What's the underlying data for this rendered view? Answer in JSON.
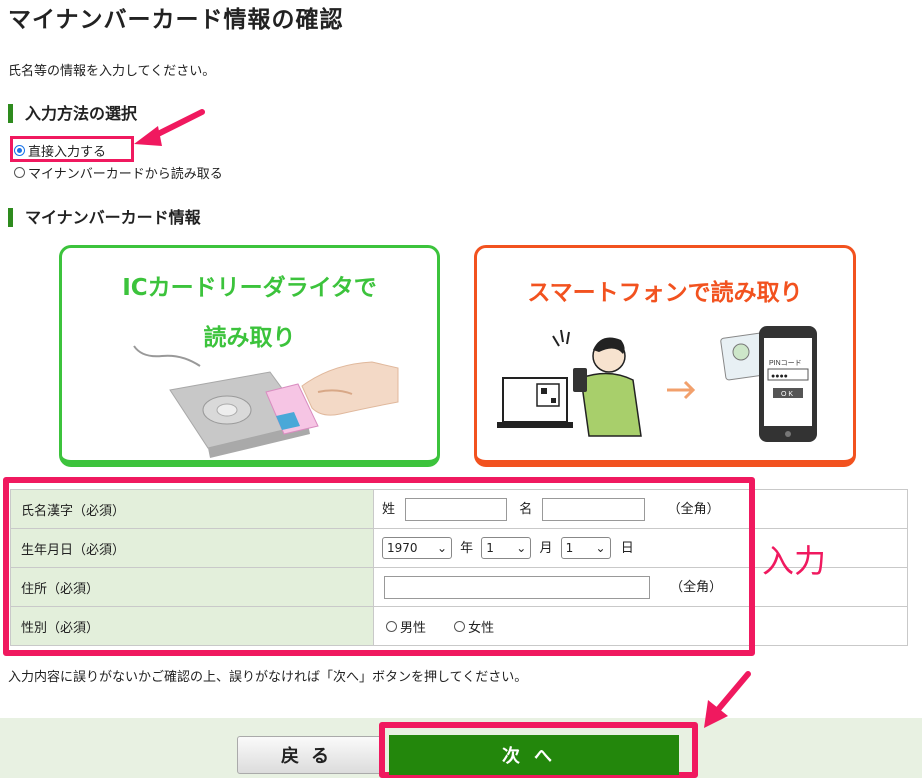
{
  "page_title": "マイナンバーカード情報の確認",
  "intro": "氏名等の情報を入力してください。",
  "input_method": {
    "heading": "入力方法の選択",
    "options": [
      {
        "label": "直接入力する",
        "selected": true
      },
      {
        "label": "マイナンバーカードから読み取る",
        "selected": false
      }
    ]
  },
  "card_info": {
    "heading": "マイナンバーカード情報",
    "ic_reader_title_line1": "ICカードリーダライタで",
    "ic_reader_title_line2": "読み取り",
    "smartphone_title": "スマートフォンで読み取り",
    "phone_pin_label": "PINコード",
    "phone_pin_dots": "●●●●",
    "phone_ok": "O K"
  },
  "form": {
    "name": {
      "label": "氏名漢字（必須）",
      "last_prefix": "姓",
      "first_prefix": "名",
      "note": "（全角）",
      "last_value": "",
      "first_value": ""
    },
    "birthdate": {
      "label": "生年月日（必須）",
      "year": "1970",
      "year_unit": "年",
      "month": "1",
      "month_unit": "月",
      "day": "1",
      "day_unit": "日"
    },
    "address": {
      "label": "住所（必須）",
      "value": "",
      "note": "（全角）"
    },
    "gender": {
      "label": "性別（必須）",
      "options": [
        "男性",
        "女性"
      ]
    }
  },
  "confirm_note": "入力内容に誤りがないかご確認の上、誤りがなければ「次へ」ボタンを押してください。",
  "buttons": {
    "back": "戻る",
    "next": "次へ"
  },
  "annotation": {
    "label": "入力"
  },
  "colors": {
    "accent_green": "#23870c",
    "card_green": "#3cc33c",
    "card_orange": "#f2521f",
    "annotation_pink": "#f0195f",
    "label_bg": "#e3efdb"
  }
}
